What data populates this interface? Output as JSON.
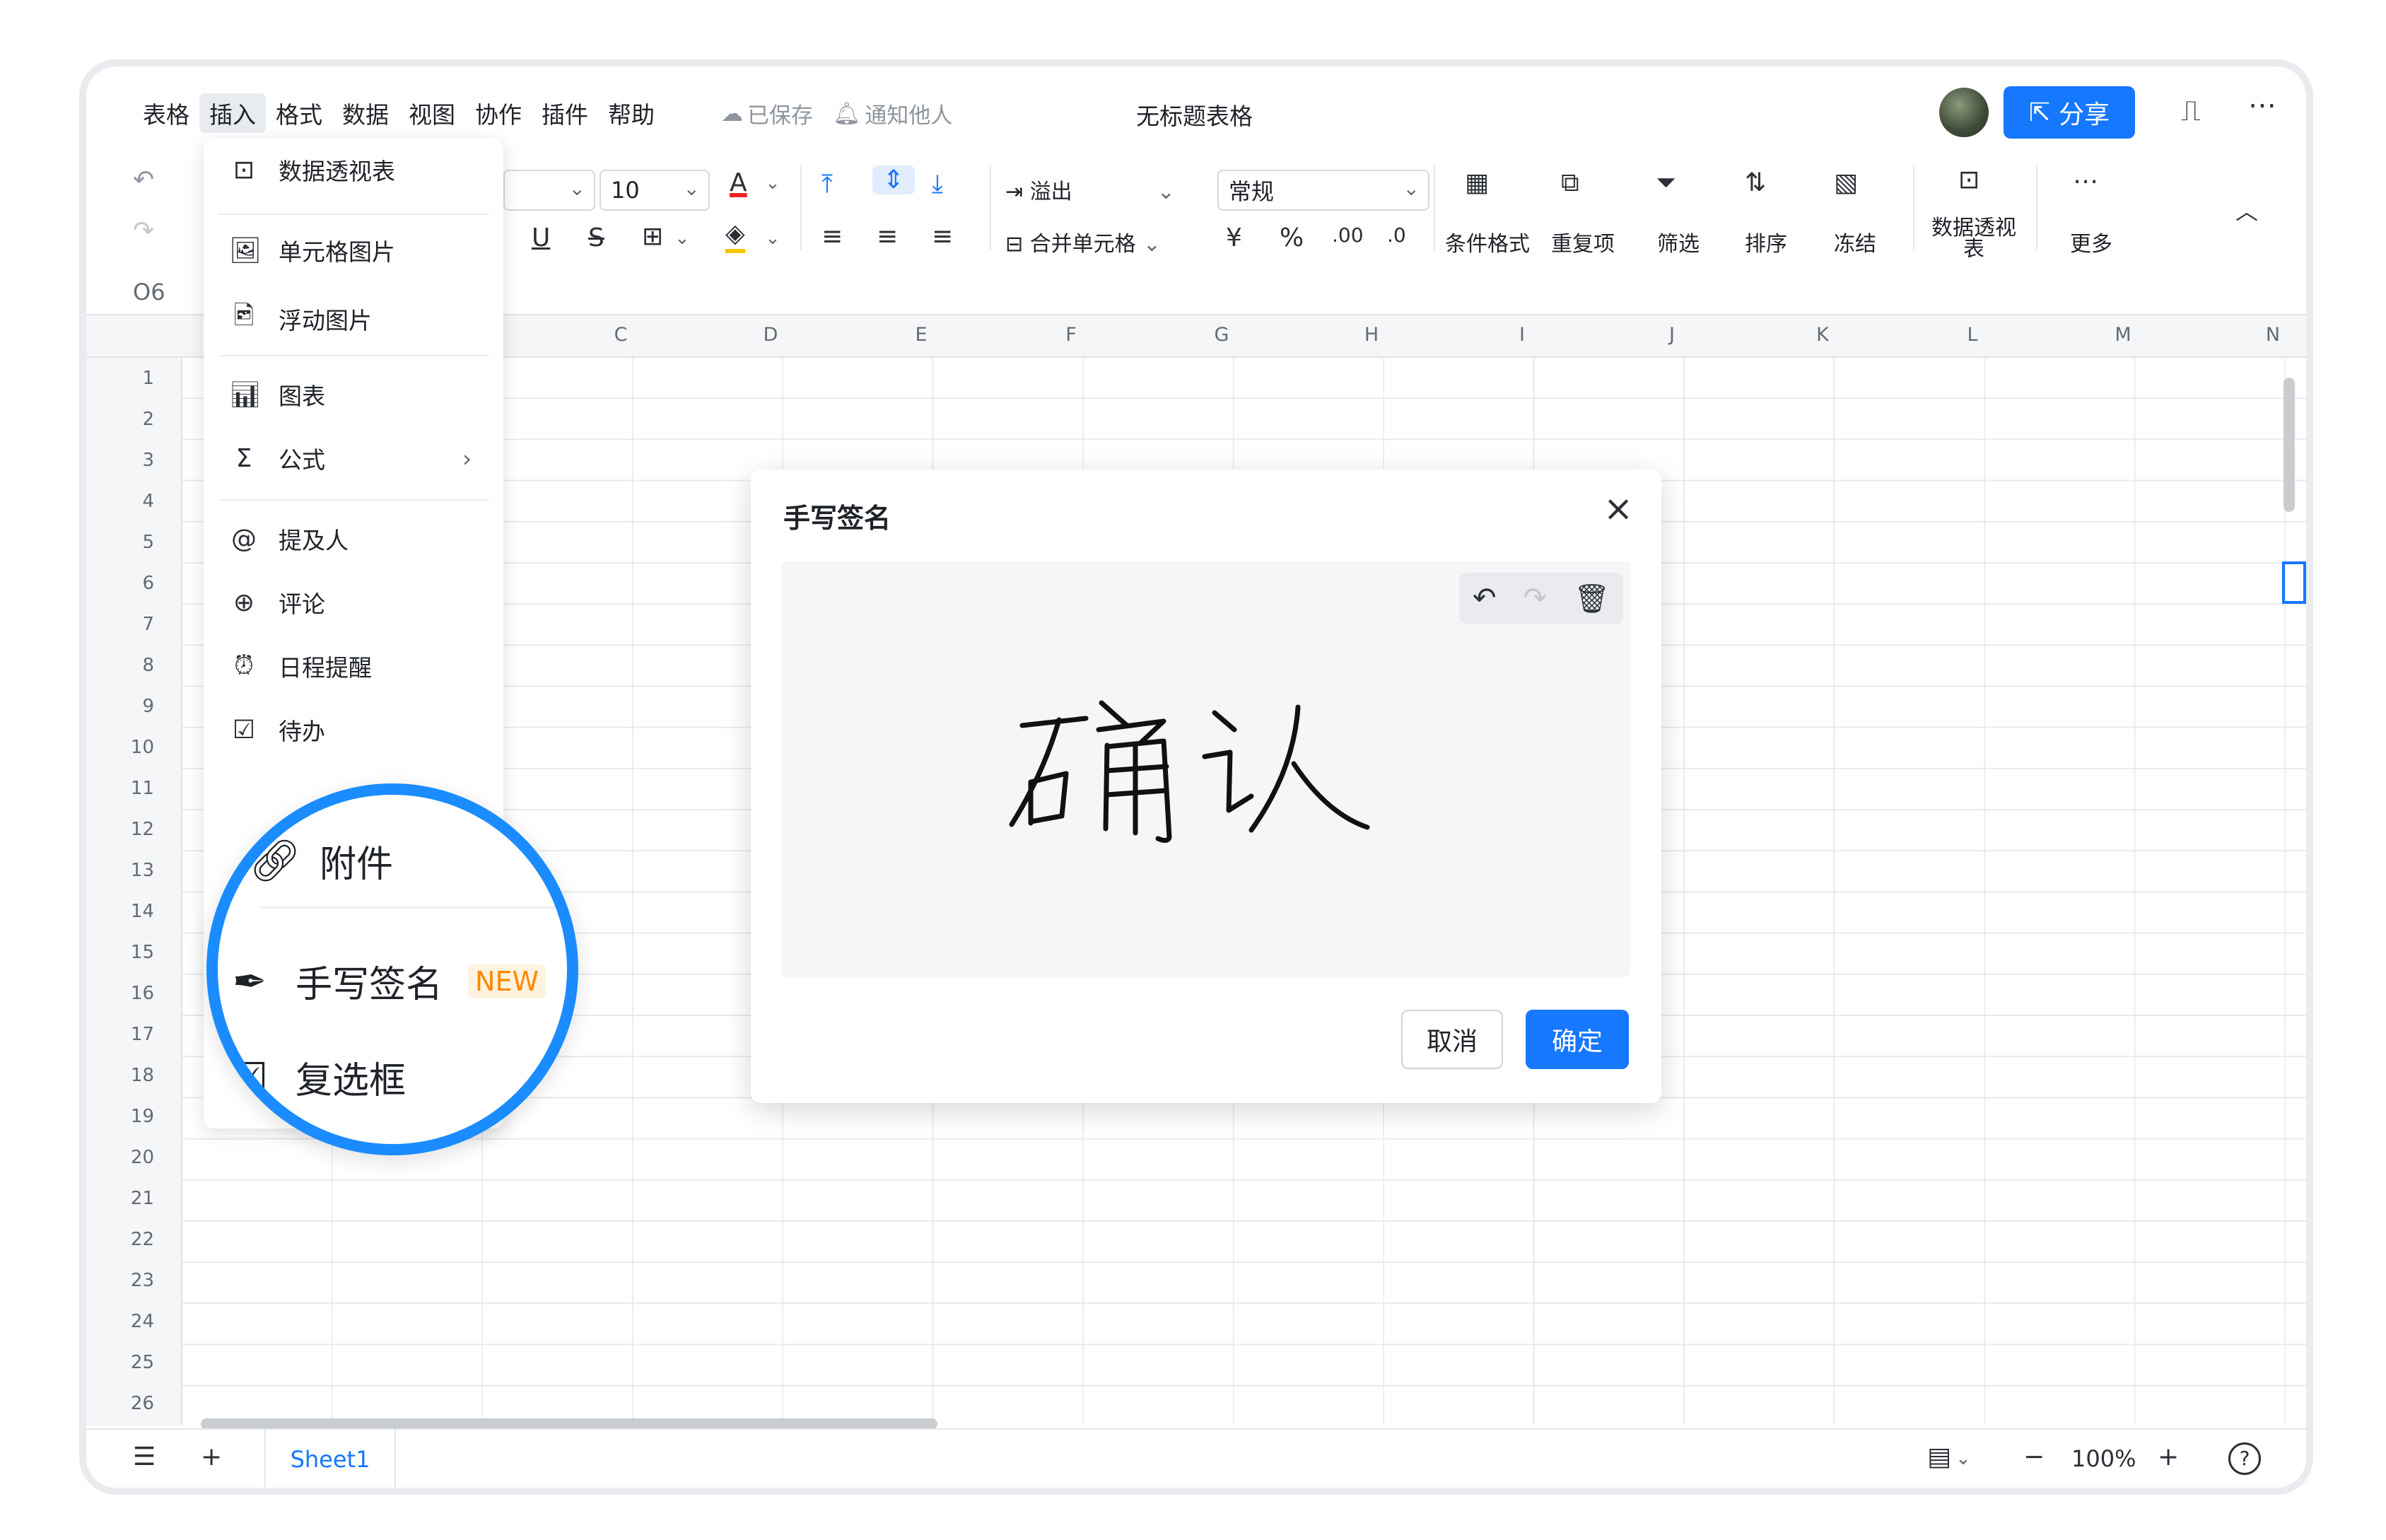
{
  "menubar": {
    "items": [
      "表格",
      "插入",
      "格式",
      "数据",
      "视图",
      "协作",
      "插件",
      "帮助"
    ],
    "saved": "已保存",
    "notify": "通知他人",
    "title": "无标题表格"
  },
  "header": {
    "share_label": "分享"
  },
  "toolbar": {
    "font_size": "10",
    "overflow_label": "溢出",
    "merge_label": "合并单元格",
    "number_format": "常规",
    "currency_symbol": "¥",
    "percent_symbol": "%",
    "cond_format": "条件格式",
    "duplicates": "重复项",
    "filter": "筛选",
    "sort": "排序",
    "freeze": "冻结",
    "pivot": "数据透视表",
    "more": "更多"
  },
  "namebox": "O6",
  "columns": [
    "C",
    "D",
    "E",
    "F",
    "G",
    "H",
    "I",
    "J",
    "K",
    "L",
    "M",
    "N"
  ],
  "rows": [
    "1",
    "2",
    "3",
    "4",
    "5",
    "6",
    "7",
    "8",
    "9",
    "10",
    "11",
    "12",
    "13",
    "14",
    "15",
    "16",
    "17",
    "18",
    "19",
    "20",
    "21",
    "22",
    "23",
    "24",
    "25",
    "26"
  ],
  "insert_menu": {
    "items": [
      {
        "label": "数据透视表",
        "icon": "pivot-icon"
      },
      {
        "label": "单元格图片",
        "icon": "image-icon"
      },
      {
        "label": "浮动图片",
        "icon": "float-image-icon"
      },
      {
        "label": "图表",
        "icon": "chart-icon"
      },
      {
        "label": "公式",
        "icon": "sigma-icon"
      },
      {
        "label": "提及人",
        "icon": "at-icon"
      },
      {
        "label": "评论",
        "icon": "comment-icon"
      },
      {
        "label": "日程提醒",
        "icon": "alarm-icon"
      },
      {
        "label": "待办",
        "icon": "todo-icon"
      }
    ]
  },
  "magnifier": {
    "attachment": "附件",
    "signature": "手写签名",
    "new_badge": "NEW",
    "checkbox": "复选框"
  },
  "dialog": {
    "title": "手写签名",
    "signature_text": "确认",
    "cancel": "取消",
    "confirm": "确定"
  },
  "bottom": {
    "sheet_tab": "Sheet1",
    "zoom": "100%"
  },
  "colors": {
    "accent": "#1677ff",
    "magnifier_ring": "#1a8cff",
    "badge": "#ff8800"
  }
}
